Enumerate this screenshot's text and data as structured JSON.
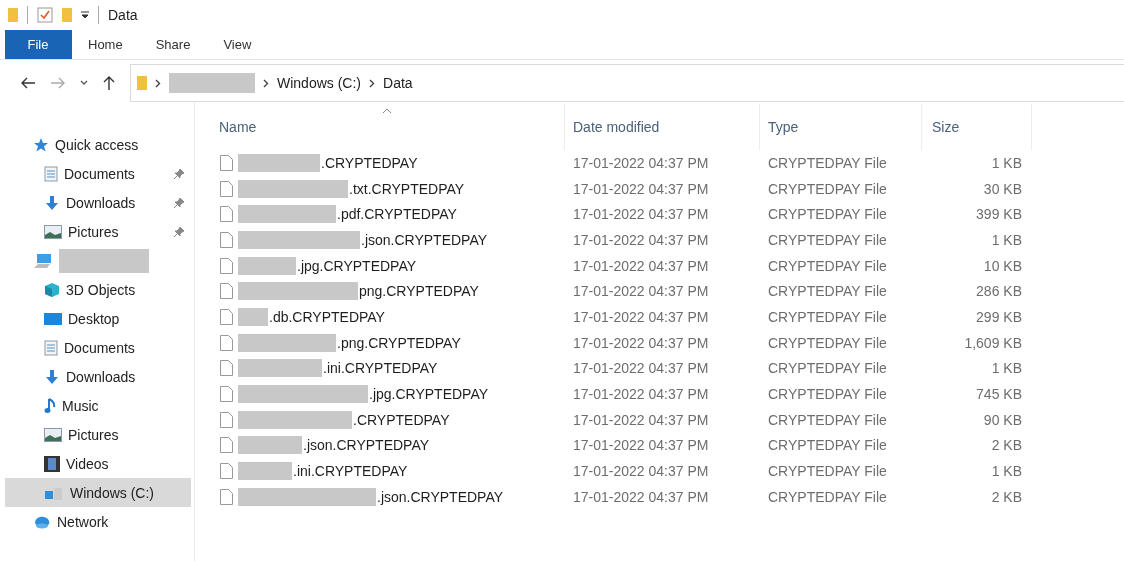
{
  "window": {
    "title": "Data"
  },
  "ribbon_tabs": [
    {
      "label": "File",
      "selected": true
    },
    {
      "label": "Home",
      "selected": false
    },
    {
      "label": "Share",
      "selected": false
    },
    {
      "label": "View",
      "selected": false
    }
  ],
  "address": {
    "crumbs": [
      {
        "redacted": true
      },
      {
        "label": "Windows (C:)",
        "redacted": false
      },
      {
        "label": "Data",
        "redacted": false
      }
    ]
  },
  "sidebar": {
    "items": [
      {
        "label": "Quick access",
        "redacted": false,
        "selected": false,
        "children": [
          {
            "label": "Documents",
            "pinned": true,
            "selected": false
          },
          {
            "label": "Downloads",
            "pinned": true,
            "selected": false
          },
          {
            "label": "Pictures",
            "pinned": true,
            "selected": false
          }
        ]
      },
      {
        "redacted": true,
        "selected": false,
        "children": [
          {
            "label": "3D Objects",
            "pinned": false,
            "selected": false
          },
          {
            "label": "Desktop",
            "pinned": false,
            "selected": false
          },
          {
            "label": "Documents",
            "pinned": false,
            "selected": false
          },
          {
            "label": "Downloads",
            "pinned": false,
            "selected": false
          },
          {
            "label": "Music",
            "pinned": false,
            "selected": false
          },
          {
            "label": "Pictures",
            "pinned": false,
            "selected": false
          },
          {
            "label": "Videos",
            "pinned": false,
            "selected": false
          },
          {
            "label": "Windows (C:)",
            "pinned": false,
            "selected": true
          }
        ]
      },
      {
        "label": "Network",
        "redacted": false,
        "selected": false
      }
    ]
  },
  "table": {
    "columns": [
      {
        "label": "Name",
        "sorted": true
      },
      {
        "label": "Date modified",
        "sorted": false
      },
      {
        "label": "Type",
        "sorted": false
      },
      {
        "label": "Size",
        "sorted": false
      }
    ],
    "rows": [
      {
        "name": ".CRYPTEDPAY",
        "redacted": true,
        "date": "17-01-2022 04:37 PM",
        "type": "CRYPTEDPAY File",
        "size": "1 KB"
      },
      {
        "name": ".txt.CRYPTEDPAY",
        "redacted": true,
        "date": "17-01-2022 04:37 PM",
        "type": "CRYPTEDPAY File",
        "size": "30 KB"
      },
      {
        "name": ".pdf.CRYPTEDPAY",
        "redacted": true,
        "date": "17-01-2022 04:37 PM",
        "type": "CRYPTEDPAY File",
        "size": "399 KB"
      },
      {
        "name": ".json.CRYPTEDPAY",
        "redacted": true,
        "date": "17-01-2022 04:37 PM",
        "type": "CRYPTEDPAY File",
        "size": "1 KB"
      },
      {
        "name": ".jpg.CRYPTEDPAY",
        "redacted": true,
        "date": "17-01-2022 04:37 PM",
        "type": "CRYPTEDPAY File",
        "size": "10 KB"
      },
      {
        "name": "png.CRYPTEDPAY",
        "redacted": true,
        "date": "17-01-2022 04:37 PM",
        "type": "CRYPTEDPAY File",
        "size": "286 KB"
      },
      {
        "name": ".db.CRYPTEDPAY",
        "redacted": true,
        "date": "17-01-2022 04:37 PM",
        "type": "CRYPTEDPAY File",
        "size": "299 KB"
      },
      {
        "name": ".png.CRYPTEDPAY",
        "redacted": true,
        "date": "17-01-2022 04:37 PM",
        "type": "CRYPTEDPAY File",
        "size": "1,609 KB"
      },
      {
        "name": ".ini.CRYPTEDPAY",
        "redacted": true,
        "date": "17-01-2022 04:37 PM",
        "type": "CRYPTEDPAY File",
        "size": "1 KB"
      },
      {
        "name": ".jpg.CRYPTEDPAY",
        "redacted": true,
        "date": "17-01-2022 04:37 PM",
        "type": "CRYPTEDPAY File",
        "size": "745 KB"
      },
      {
        "name": ".CRYPTEDPAY",
        "redacted": true,
        "date": "17-01-2022 04:37 PM",
        "type": "CRYPTEDPAY File",
        "size": "90 KB"
      },
      {
        "name": ".json.CRYPTEDPAY",
        "redacted": true,
        "date": "17-01-2022 04:37 PM",
        "type": "CRYPTEDPAY File",
        "size": "2 KB"
      },
      {
        "name": ".ini.CRYPTEDPAY",
        "redacted": true,
        "date": "17-01-2022 04:37 PM",
        "type": "CRYPTEDPAY File",
        "size": "1 KB"
      },
      {
        "name": ".json.CRYPTEDPAY",
        "redacted": true,
        "date": "17-01-2022 04:37 PM",
        "type": "CRYPTEDPAY File",
        "size": "2 KB"
      }
    ]
  }
}
